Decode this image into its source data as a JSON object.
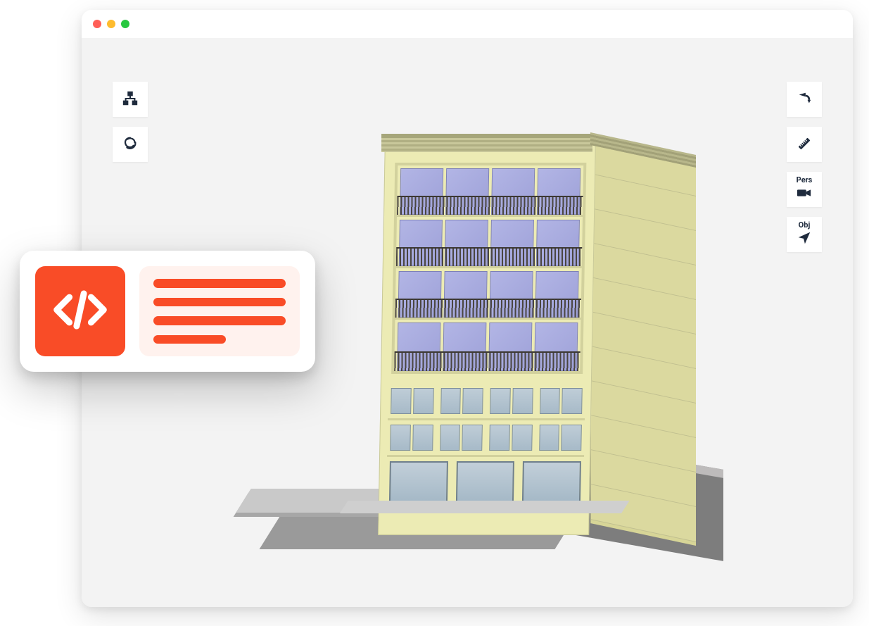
{
  "window": {
    "traffic_lights": [
      "close",
      "minimize",
      "maximize"
    ]
  },
  "left_toolbar": {
    "hierarchy_tooltip": "Hierarchy",
    "layers_tooltip": "Layers"
  },
  "right_toolbar": {
    "rotate_tooltip": "Rotate",
    "measure_tooltip": "Measure",
    "camera_label": "Pers",
    "orientation_label": "Obj"
  },
  "overlay": {
    "code_tile_name": "code-icon",
    "lines_tile_name": "text-lines-icon"
  },
  "colors": {
    "accent": "#f94c27",
    "icon_dark": "#1f2b3d",
    "viewport_bg": "#f3f3f3"
  }
}
